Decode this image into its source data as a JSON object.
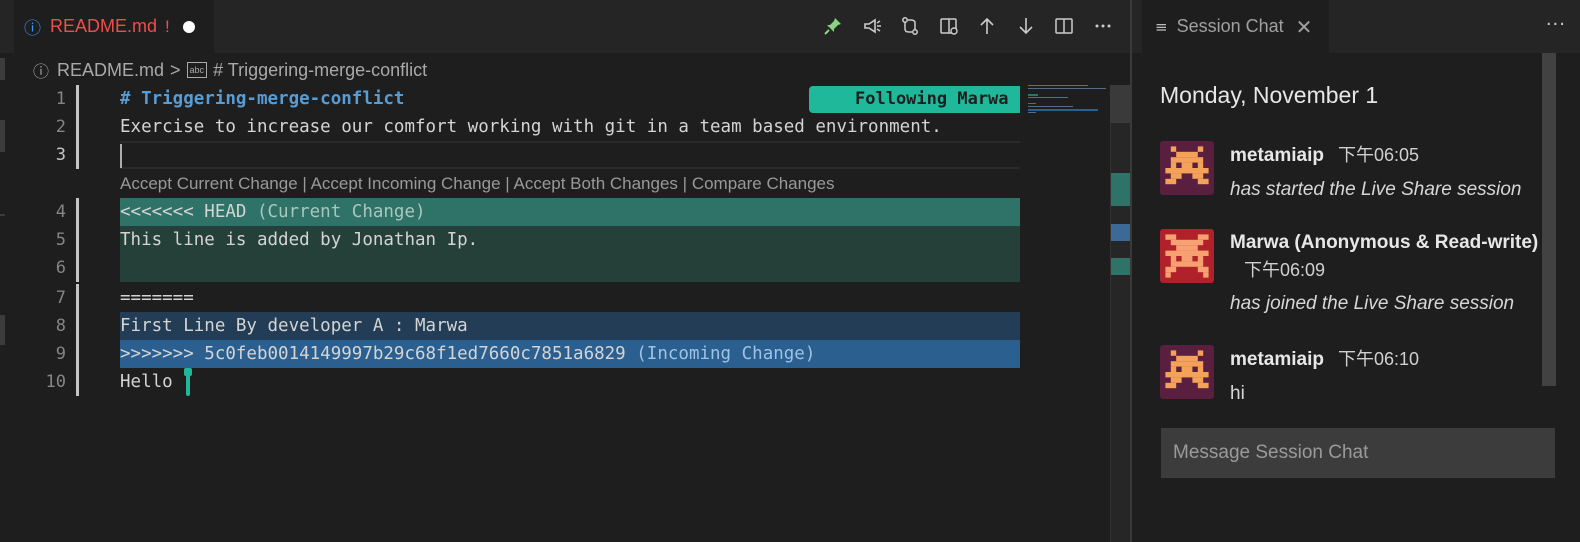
{
  "editor": {
    "tab": {
      "filename": "README.md",
      "warning_mark": "!",
      "icon": "info-icon",
      "modified": true
    },
    "actions": [
      {
        "name": "pin-icon",
        "color": "#89d185"
      },
      {
        "name": "megaphone-icon",
        "color": "#cccccc"
      },
      {
        "name": "git-compare-icon",
        "color": "#cccccc"
      },
      {
        "name": "open-changes-icon",
        "color": "#cccccc"
      },
      {
        "name": "arrow-up-icon",
        "color": "#cccccc"
      },
      {
        "name": "arrow-down-icon",
        "color": "#cccccc"
      },
      {
        "name": "split-editor-icon",
        "color": "#cccccc"
      },
      {
        "name": "more-actions-icon",
        "color": "#cccccc"
      }
    ],
    "breadcrumb": {
      "file": "README.md",
      "separator": ">",
      "symbol": "# Triggering-merge-conflict",
      "symbol_icon": "abc"
    },
    "follow_badge": "Following Marwa",
    "codelens": {
      "accept_current": "Accept Current Change",
      "accept_incoming": "Accept Incoming Change",
      "accept_both": "Accept Both Changes",
      "compare": "Compare Changes",
      "separator": " | "
    },
    "lines": [
      {
        "num": "1",
        "text": "# Triggering-merge-conflict",
        "hint": ""
      },
      {
        "num": "2",
        "text": "Exercise to increase our comfort working with git in a team based environment.",
        "hint": ""
      },
      {
        "num": "3",
        "text": "",
        "hint": ""
      },
      {
        "num": "4",
        "text": "<<<<<<< HEAD ",
        "hint": "(Current Change)"
      },
      {
        "num": "5",
        "text": "This line is added by Jonathan Ip.",
        "hint": ""
      },
      {
        "num": "6",
        "text": "",
        "hint": ""
      },
      {
        "num": "7",
        "text": "=======",
        "hint": ""
      },
      {
        "num": "8",
        "text": "First Line By developer A : Marwa",
        "hint": ""
      },
      {
        "num": "9",
        "text": ">>>>>>> 5c0feb0014149997b29c68f1ed7660c7851a6829 ",
        "hint": "(Incoming Change)"
      },
      {
        "num": "10",
        "text": "Hello",
        "hint": ""
      }
    ],
    "colors": {
      "current_change_header": "#2e7268",
      "current_change": "#244038",
      "incoming_change": "#223d55",
      "incoming_change_header": "#2b5f8f",
      "participant_cursor": "#1fb89b"
    }
  },
  "chat": {
    "tab_title": "Session Chat",
    "date": "Monday, November 1",
    "messages": [
      {
        "author": "metamiaip",
        "time": "下午06:05",
        "text": "has started the Live Share session",
        "italic": true,
        "avatar_color": "#f4a259",
        "avatar_bg": "#5a1f3f"
      },
      {
        "author": "Marwa (Anonymous & Read-write)",
        "time": "下午06:09",
        "text": "has joined the Live Share session",
        "italic": true,
        "avatar_color": "#f7a072",
        "avatar_bg": "#b0212a"
      },
      {
        "author": "metamiaip",
        "time": "下午06:10",
        "text": "hi",
        "italic": false,
        "avatar_color": "#f4a259",
        "avatar_bg": "#5a1f3f"
      }
    ],
    "input_placeholder": "Message Session Chat"
  }
}
